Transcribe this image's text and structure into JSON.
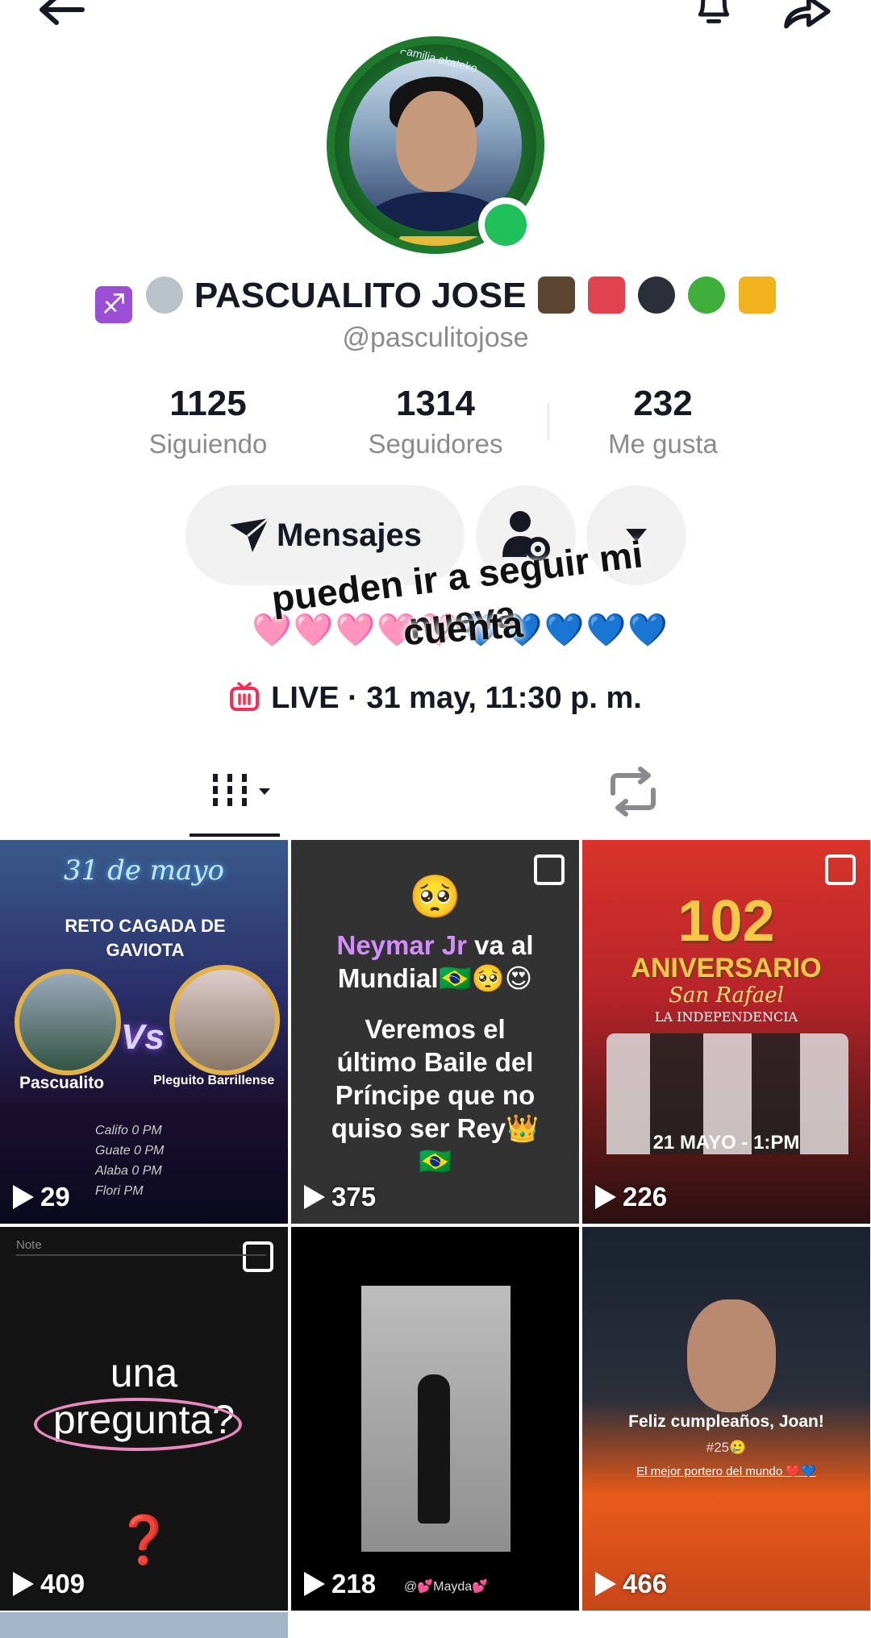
{
  "profile": {
    "name": "PASCUALITO JOSE",
    "handle": "@pasculitojose",
    "avatar_ring_text": "Familia akateko",
    "name_emoji_before": [
      "sagittarius-emoji",
      "alien-emoji"
    ],
    "name_emoji_after": [
      "eagle-emoji",
      "dancer-emoji",
      "ninja-emoji",
      "clover-emoji",
      "beer-emoji"
    ]
  },
  "stats": [
    {
      "value": "1125",
      "label": "Siguiendo"
    },
    {
      "value": "1314",
      "label": "Seguidores"
    },
    {
      "value": "232",
      "label": "Me gusta"
    }
  ],
  "buttons": {
    "message_label": "Mensajes"
  },
  "sticker": {
    "line1": "pueden ir a seguir mi nueva",
    "line2": "cuenta",
    "hearts": "🩷🩷🩷🩷🩷💙💙💙💙💙"
  },
  "live": {
    "text": "LIVE · 31 may, 11:30 p. m."
  },
  "colors": {
    "online": "#20c05a",
    "accent_live": "#fe2c55",
    "text": "#161823",
    "muted": "#8a8b91"
  },
  "videos": [
    {
      "views": "29",
      "title": "31 de mayo",
      "caption": "RETO CAGADA DE GAVIOTA",
      "left_name": "Pascualito",
      "right_name": "Pleguito Barrillense",
      "vs": "Vs",
      "lines": [
        "Califo  0 PM",
        "Guate  0 PM",
        "Alaba  0 PM",
        "Flori  PM"
      ]
    },
    {
      "views": "375",
      "lines": [
        "🥺",
        "Neymar Jr va al",
        "Mundial🇧🇷🥺😍",
        "",
        "Veremos el",
        "último Baile del",
        "Príncipe que no",
        "quiso ser Rey👑",
        "🇧🇷"
      ],
      "multi": true
    },
    {
      "views": "226",
      "big": "102",
      "sub": "ANIVERSARIO",
      "script": "San Rafael",
      "date": "21 MAYO - 1:PM",
      "small": "LA INDEPENDENCIA",
      "multi": true
    },
    {
      "views": "409",
      "note_label": "Note",
      "word1": "una",
      "word2": "pregunta?",
      "qmark": "❓",
      "multi": true
    },
    {
      "views": "218",
      "tag": "@💕Mayda💕"
    },
    {
      "views": "466",
      "caption": "Feliz cumpleaños, Joan!",
      "tag": "#25🥲",
      "sub": "El mejor portero del mundo ❤️💙"
    }
  ]
}
